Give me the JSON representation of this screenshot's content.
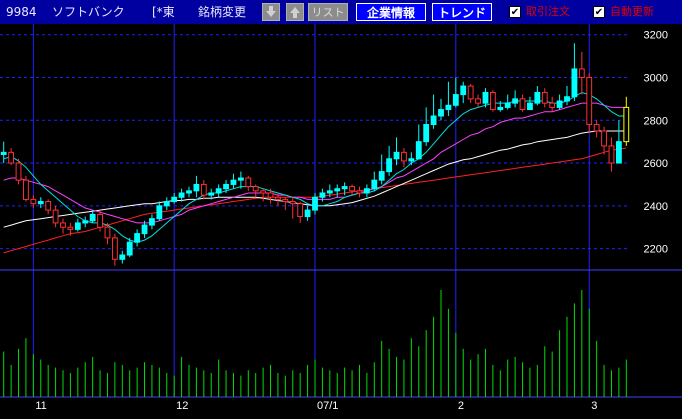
{
  "toolbar": {
    "code": "9984",
    "name": "ソフトバンク",
    "market": "[*東",
    "change_label": "銘柄変更",
    "down_icon": "down-arrow-icon",
    "up_icon": "up-arrow-icon",
    "list_label": "リスト",
    "info_label": "企業情報",
    "trend_label": "トレンド",
    "checkbox1": {
      "checked": true,
      "label": "取引注文"
    },
    "checkbox2": {
      "checked": true,
      "label": "自動更新"
    },
    "check_mark": "✔"
  },
  "colors": {
    "background": "#000000",
    "toolbar": "#0000a0",
    "grid": "#2020ff",
    "divider": "#4040ff",
    "up_candle": "#00ffff",
    "down_candle": "#ff3030",
    "last_candle": "#ffff00",
    "volume": "#00dd00",
    "ma_short": "#00e0e0",
    "ma_mid": "#ff40ff",
    "ma_long": "#ffffff",
    "ma_longest": "#ff2020"
  },
  "chart_data": {
    "type": "candlestick",
    "ylim": [
      2100,
      3250
    ],
    "yticks": [
      2200,
      2400,
      2600,
      2800,
      3000,
      3200
    ],
    "x_labels": [
      {
        "label": "11",
        "index": 4
      },
      {
        "label": "12",
        "index": 23
      },
      {
        "label": "07/1",
        "index": 42
      },
      {
        "label": "2",
        "index": 61
      },
      {
        "label": "3",
        "index": 79
      }
    ],
    "open": [
      2640,
      2650,
      2600,
      2520,
      2430,
      2410,
      2420,
      2380,
      2320,
      2300,
      2290,
      2320,
      2330,
      2360,
      2300,
      2250,
      2150,
      2170,
      2230,
      2270,
      2310,
      2340,
      2400,
      2420,
      2440,
      2460,
      2470,
      2500,
      2450,
      2460,
      2480,
      2500,
      2520,
      2530,
      2490,
      2470,
      2460,
      2440,
      2430,
      2420,
      2410,
      2350,
      2380,
      2440,
      2460,
      2470,
      2480,
      2490,
      2470,
      2460,
      2480,
      2520,
      2560,
      2620,
      2650,
      2610,
      2620,
      2700,
      2780,
      2820,
      2850,
      2870,
      2920,
      2960,
      2900,
      2880,
      2930,
      2850,
      2860,
      2880,
      2900,
      2850,
      2880,
      2930,
      2880,
      2860,
      2890,
      2910,
      3040,
      3000,
      2780,
      2750,
      2680,
      2600,
      2700
    ],
    "close": [
      2650,
      2600,
      2520,
      2430,
      2410,
      2420,
      2380,
      2320,
      2300,
      2290,
      2320,
      2330,
      2360,
      2300,
      2250,
      2150,
      2170,
      2230,
      2270,
      2310,
      2340,
      2400,
      2420,
      2440,
      2460,
      2470,
      2500,
      2450,
      2460,
      2480,
      2500,
      2520,
      2530,
      2490,
      2470,
      2460,
      2440,
      2430,
      2420,
      2410,
      2350,
      2380,
      2440,
      2460,
      2470,
      2480,
      2490,
      2470,
      2460,
      2480,
      2520,
      2560,
      2620,
      2650,
      2610,
      2620,
      2700,
      2780,
      2820,
      2850,
      2870,
      2920,
      2960,
      2900,
      2880,
      2930,
      2850,
      2860,
      2880,
      2900,
      2850,
      2880,
      2930,
      2880,
      2860,
      2890,
      2910,
      3040,
      3000,
      2780,
      2750,
      2680,
      2600,
      2700,
      2860
    ],
    "high": [
      2700,
      2670,
      2620,
      2540,
      2450,
      2440,
      2430,
      2400,
      2340,
      2320,
      2340,
      2350,
      2380,
      2380,
      2320,
      2270,
      2190,
      2250,
      2290,
      2330,
      2360,
      2420,
      2440,
      2460,
      2480,
      2490,
      2540,
      2520,
      2480,
      2500,
      2520,
      2550,
      2560,
      2540,
      2500,
      2480,
      2480,
      2460,
      2440,
      2440,
      2420,
      2400,
      2460,
      2480,
      2500,
      2500,
      2510,
      2500,
      2490,
      2500,
      2560,
      2640,
      2680,
      2720,
      2670,
      2650,
      2780,
      2860,
      2920,
      2900,
      2980,
      3000,
      2980,
      2970,
      2920,
      2950,
      2940,
      2890,
      2920,
      2940,
      2920,
      2910,
      2960,
      2950,
      2910,
      2920,
      2960,
      3160,
      3120,
      3020,
      2800,
      2770,
      2720,
      2800,
      2910
    ],
    "low": [
      2600,
      2590,
      2500,
      2420,
      2390,
      2390,
      2360,
      2300,
      2270,
      2260,
      2280,
      2300,
      2320,
      2280,
      2220,
      2120,
      2130,
      2160,
      2210,
      2250,
      2290,
      2330,
      2380,
      2410,
      2420,
      2440,
      2440,
      2430,
      2430,
      2440,
      2460,
      2480,
      2480,
      2470,
      2440,
      2420,
      2410,
      2400,
      2380,
      2340,
      2320,
      2330,
      2360,
      2420,
      2440,
      2440,
      2450,
      2450,
      2440,
      2440,
      2470,
      2500,
      2540,
      2590,
      2580,
      2590,
      2620,
      2680,
      2760,
      2800,
      2820,
      2860,
      2880,
      2880,
      2860,
      2860,
      2840,
      2840,
      2850,
      2860,
      2840,
      2850,
      2870,
      2860,
      2840,
      2850,
      2870,
      2890,
      2920,
      2740,
      2720,
      2640,
      2560,
      2620,
      2680
    ],
    "volume": [
      17,
      12,
      18,
      22,
      16,
      14,
      12,
      11,
      10,
      9,
      11,
      13,
      15,
      10,
      9,
      13,
      12,
      10,
      11,
      13,
      12,
      11,
      9,
      8,
      15,
      12,
      11,
      10,
      9,
      14,
      10,
      9,
      8,
      10,
      9,
      11,
      12,
      9,
      8,
      10,
      9,
      12,
      14,
      11,
      10,
      9,
      11,
      10,
      12,
      9,
      13,
      21,
      18,
      15,
      14,
      22,
      19,
      25,
      30,
      40,
      33,
      24,
      18,
      14,
      16,
      18,
      12,
      10,
      14,
      15,
      13,
      11,
      12,
      19,
      17,
      25,
      30,
      35,
      40,
      33,
      21,
      12,
      10,
      11,
      14
    ],
    "ma_short": [
      2620,
      2630,
      2610,
      2580,
      2540,
      2500,
      2470,
      2440,
      2410,
      2380,
      2350,
      2330,
      2320,
      2320,
      2310,
      2290,
      2260,
      2240,
      2230,
      2240,
      2260,
      2290,
      2320,
      2350,
      2380,
      2410,
      2430,
      2450,
      2460,
      2460,
      2470,
      2480,
      2490,
      2490,
      2490,
      2480,
      2470,
      2460,
      2450,
      2440,
      2430,
      2410,
      2400,
      2400,
      2410,
      2420,
      2440,
      2450,
      2460,
      2460,
      2470,
      2490,
      2520,
      2550,
      2570,
      2600,
      2620,
      2650,
      2690,
      2730,
      2770,
      2800,
      2830,
      2850,
      2860,
      2870,
      2880,
      2880,
      2880,
      2890,
      2890,
      2890,
      2890,
      2890,
      2880,
      2880,
      2890,
      2910,
      2930,
      2920,
      2900,
      2870,
      2840,
      2820,
      2820
    ],
    "ma_mid": [
      2520,
      2530,
      2530,
      2520,
      2510,
      2500,
      2490,
      2470,
      2450,
      2430,
      2410,
      2390,
      2380,
      2370,
      2360,
      2350,
      2340,
      2330,
      2320,
      2320,
      2320,
      2330,
      2340,
      2350,
      2360,
      2380,
      2390,
      2400,
      2410,
      2420,
      2430,
      2440,
      2450,
      2460,
      2460,
      2460,
      2460,
      2450,
      2450,
      2440,
      2440,
      2430,
      2430,
      2430,
      2430,
      2440,
      2440,
      2450,
      2460,
      2470,
      2480,
      2490,
      2510,
      2530,
      2540,
      2560,
      2580,
      2600,
      2620,
      2650,
      2670,
      2690,
      2710,
      2730,
      2740,
      2760,
      2770,
      2790,
      2800,
      2810,
      2810,
      2820,
      2830,
      2840,
      2840,
      2850,
      2860,
      2870,
      2880,
      2880,
      2880,
      2870,
      2860,
      2860,
      2860
    ],
    "ma_long": [
      2300,
      2310,
      2320,
      2330,
      2335,
      2340,
      2345,
      2350,
      2355,
      2360,
      2365,
      2370,
      2375,
      2380,
      2385,
      2390,
      2395,
      2400,
      2405,
      2410,
      2410,
      2415,
      2420,
      2425,
      2425,
      2430,
      2430,
      2435,
      2435,
      2440,
      2440,
      2440,
      2440,
      2440,
      2440,
      2435,
      2430,
      2425,
      2420,
      2415,
      2410,
      2405,
      2400,
      2400,
      2400,
      2405,
      2410,
      2415,
      2425,
      2435,
      2445,
      2460,
      2475,
      2490,
      2505,
      2520,
      2535,
      2550,
      2565,
      2580,
      2595,
      2605,
      2615,
      2620,
      2630,
      2640,
      2650,
      2660,
      2665,
      2675,
      2685,
      2690,
      2700,
      2705,
      2710,
      2715,
      2720,
      2730,
      2740,
      2745,
      2750,
      2750,
      2750,
      2750,
      2750
    ],
    "ma_longest": [
      2180,
      2190,
      2200,
      2210,
      2220,
      2230,
      2240,
      2250,
      2260,
      2270,
      2275,
      2280,
      2290,
      2300,
      2310,
      2320,
      2330,
      2340,
      2350,
      2360,
      2365,
      2370,
      2375,
      2380,
      2385,
      2390,
      2395,
      2400,
      2405,
      2410,
      2415,
      2420,
      2425,
      2430,
      2435,
      2440,
      2440,
      2440,
      2440,
      2440,
      2440,
      2440,
      2440,
      2445,
      2450,
      2455,
      2460,
      2465,
      2470,
      2475,
      2480,
      2485,
      2490,
      2495,
      2500,
      2505,
      2510,
      2515,
      2520,
      2525,
      2530,
      2535,
      2540,
      2545,
      2550,
      2555,
      2560,
      2565,
      2570,
      2575,
      2580,
      2585,
      2590,
      2595,
      2600,
      2605,
      2610,
      2615,
      2620,
      2630,
      2640,
      2650,
      2660,
      2665,
      2670
    ]
  }
}
